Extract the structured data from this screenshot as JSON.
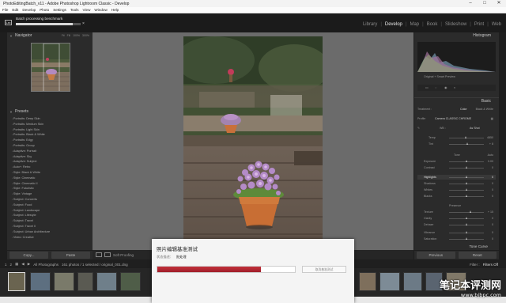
{
  "window": {
    "title": "PhotoEditingBatch_v11 - Adobe Photoshop Lightroom Classic - Develop",
    "controls": [
      "–",
      "□",
      "✕"
    ]
  },
  "menu": [
    "File",
    "Edit",
    "Develop",
    "Photo",
    "Settings",
    "Tools",
    "View",
    "Window",
    "Help"
  ],
  "identity": {
    "logo": "Lrc",
    "task_label": "Batch processing benchmark",
    "task_progress": 0.88,
    "close": "×"
  },
  "modules": [
    "Library",
    "Develop",
    "Map",
    "Book",
    "Slideshow",
    "Print",
    "Web"
  ],
  "active_module": "Develop",
  "left_panel": {
    "navigator_title": "Navigator",
    "zoom_levels": [
      "Fit",
      "Fill",
      "100%",
      "300%"
    ],
    "presets_title": "Presets",
    "presets": [
      "Portraits: Deep Skin",
      "Portraits: Medium Skin",
      "Portraits: Light Skin",
      "Portraits: Black & White",
      "Portraits: Edgy",
      "Portraits: Group",
      "Adaptive: Portrait",
      "Adaptive: Sky",
      "Adaptive: Subject",
      "Auto+: Retro",
      "Style: Black & White",
      "Style: Cinematic",
      "Style: Cinematic II",
      "Style: Futuristic",
      "Style: Vintage",
      "Subject: Concerts",
      "Subject: Food",
      "Subject: Landscape",
      "Subject: Lifestyle",
      "Subject: Travel",
      "Subject: Travel II",
      "Subject: Urban Architecture",
      "Video: Creative"
    ],
    "copy_label": "Copy...",
    "paste_label": "Paste"
  },
  "toolbar": {
    "soft_proofing": "Soft Proofing"
  },
  "right_panel": {
    "histogram_title": "Histogram",
    "histogram_info": "Original + Smart Preview",
    "basic_title": "Basic",
    "treatment_label": "Treatment :",
    "treatment_color": "Color",
    "treatment_bw": "Black & White",
    "profile_label": "Profile",
    "profile_value": "Camera CLASSIC CHROME",
    "wb_label": "WB :",
    "wb_value": "As Shot",
    "temp_label": "Temp",
    "temp_value": "4850",
    "tint_label": "Tint",
    "tint_value": "+ 8",
    "tone_label": "Tone",
    "tone_auto": "Auto",
    "exposure_label": "Exposure",
    "exposure_value": "0.00",
    "contrast_label": "Contrast",
    "contrast_value": "0",
    "highlights_label": "Highlights",
    "highlights_value": "0",
    "shadows_label": "Shadows",
    "shadows_value": "0",
    "whites_label": "Whites",
    "whites_value": "0",
    "blacks_label": "Blacks",
    "blacks_value": "0",
    "presence_label": "Presence",
    "texture_label": "Texture",
    "texture_value": "+ 15",
    "clarity_label": "Clarity",
    "clarity_value": "0",
    "dehaze_label": "Dehaze",
    "dehaze_value": "0",
    "vibrance_label": "Vibrance",
    "vibrance_value": "0",
    "saturation_label": "Saturation",
    "saturation_value": "0",
    "tone_curve_title": "Tone Curve",
    "previous_label": "Previous",
    "reset_label": "Reset"
  },
  "filmstrip": {
    "page1": "1",
    "page2": "2",
    "source": "All Photographs",
    "count": "161 photos / 1 selected / original_001.dng",
    "filter_label": "Filter :",
    "filter_value": "Filters Off"
  },
  "dialog": {
    "title": "照片编辑基准测试",
    "status_label": "状态描述：",
    "status_value": "批处理",
    "progress": 0.75,
    "button_label": "取消基准测试"
  },
  "watermark": {
    "line1": "笔记本评测网",
    "line2": "www.bjbpc.com"
  }
}
